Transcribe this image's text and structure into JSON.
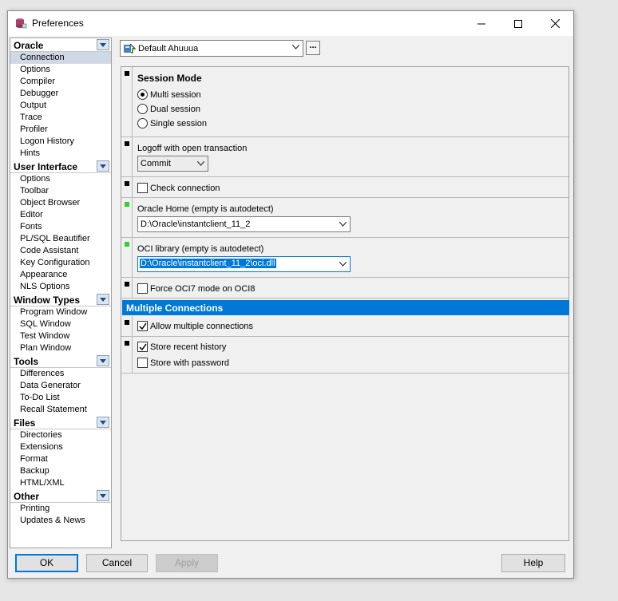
{
  "window": {
    "title": "Preferences"
  },
  "sidebar": {
    "categories": [
      {
        "label": "Oracle",
        "items": [
          "Connection",
          "Options",
          "Compiler",
          "Debugger",
          "Output",
          "Trace",
          "Profiler",
          "Logon History",
          "Hints"
        ]
      },
      {
        "label": "User Interface",
        "items": [
          "Options",
          "Toolbar",
          "Object Browser",
          "Editor",
          "Fonts",
          "PL/SQL Beautifier",
          "Code Assistant",
          "Key Configuration",
          "Appearance",
          "NLS Options"
        ]
      },
      {
        "label": "Window Types",
        "items": [
          "Program Window",
          "SQL Window",
          "Test Window",
          "Plan Window"
        ]
      },
      {
        "label": "Tools",
        "items": [
          "Differences",
          "Data Generator",
          "To-Do List",
          "Recall Statement"
        ]
      },
      {
        "label": "Files",
        "items": [
          "Directories",
          "Extensions",
          "Format",
          "Backup",
          "HTML/XML"
        ]
      },
      {
        "label": "Other",
        "items": [
          "Printing",
          "Updates & News"
        ]
      }
    ],
    "selected": "Connection"
  },
  "profile": {
    "value": "Default Ahuuua",
    "more_label": "..."
  },
  "session_mode": {
    "title": "Session Mode",
    "options": [
      "Multi session",
      "Dual session",
      "Single session"
    ],
    "selected": "Multi session"
  },
  "logoff": {
    "label": "Logoff with open transaction",
    "value": "Commit"
  },
  "check_connection": {
    "label": "Check connection",
    "checked": false
  },
  "oracle_home": {
    "label": "Oracle Home (empty is autodetect)",
    "value": "D:\\Oracle\\instantclient_11_2"
  },
  "oci_library": {
    "label": "OCI library (empty is autodetect)",
    "value": "D:\\Oracle\\instantclient_11_2\\oci.dll"
  },
  "force_oci7": {
    "label": "Force OCI7 mode on OCI8",
    "checked": false
  },
  "multiple_connections": {
    "header": "Multiple Connections",
    "allow_label": "Allow multiple connections",
    "allow_checked": true,
    "store_history_label": "Store recent history",
    "store_history_checked": true,
    "store_password_label": "Store with password",
    "store_password_checked": false
  },
  "buttons": {
    "ok": "OK",
    "cancel": "Cancel",
    "apply": "Apply",
    "help": "Help"
  },
  "colors": {
    "accent": "#0078d7",
    "marker_green": "#2bd42b"
  }
}
